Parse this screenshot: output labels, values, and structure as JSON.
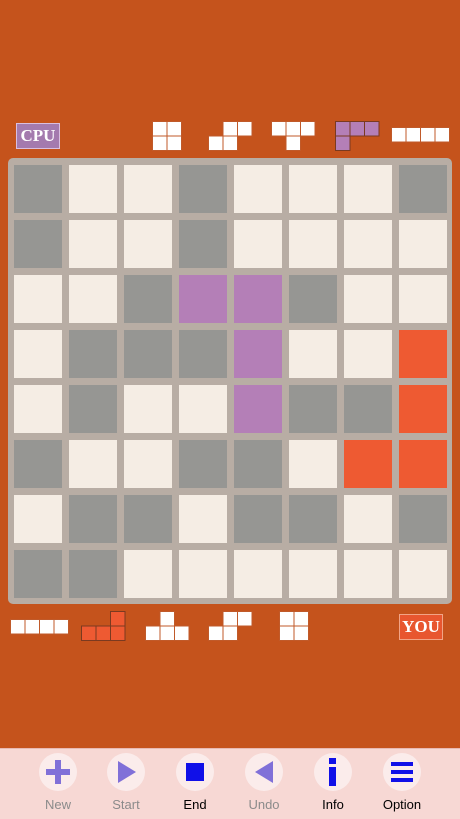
{
  "labels": {
    "cpu": "CPU",
    "you": "YOU"
  },
  "colors": {
    "background": "#c5531c",
    "board": "#b8ada4",
    "empty": "#f5ede4",
    "gray": "#969693",
    "cpu": "#b47fb7",
    "you": "#ee5a32",
    "tray_piece": "#ffffff"
  },
  "board": {
    "grid": [
      "GEEGEEEG",
      "GEEGEEEE",
      "EEGCCGEE",
      "EGGGCEEY",
      "EGEECGGY",
      "GEEGGEYY",
      "EGGEGGEG",
      "GGEEEEEE"
    ]
  },
  "cpu_pieces": [
    {
      "name": "square",
      "cells": [
        [
          0,
          0
        ],
        [
          1,
          0
        ],
        [
          0,
          1
        ],
        [
          1,
          1
        ]
      ],
      "used": false
    },
    {
      "name": "s-tetromino",
      "cells": [
        [
          1,
          0
        ],
        [
          2,
          0
        ],
        [
          0,
          1
        ],
        [
          1,
          1
        ]
      ],
      "used": false
    },
    {
      "name": "t-tetromino",
      "cells": [
        [
          0,
          0
        ],
        [
          1,
          0
        ],
        [
          2,
          0
        ],
        [
          1,
          1
        ]
      ],
      "used": false
    },
    {
      "name": "l-tetromino",
      "cells": [
        [
          0,
          0
        ],
        [
          1,
          0
        ],
        [
          2,
          0
        ],
        [
          0,
          1
        ]
      ],
      "used": true
    },
    {
      "name": "i-tetromino",
      "cells": [
        [
          0,
          0
        ],
        [
          1,
          0
        ],
        [
          2,
          0
        ],
        [
          3,
          0
        ]
      ],
      "used": false
    }
  ],
  "you_pieces": [
    {
      "name": "i-tetromino",
      "cells": [
        [
          0,
          0
        ],
        [
          1,
          0
        ],
        [
          2,
          0
        ],
        [
          3,
          0
        ]
      ],
      "used": false
    },
    {
      "name": "l-tetromino",
      "cells": [
        [
          2,
          0
        ],
        [
          0,
          1
        ],
        [
          1,
          1
        ],
        [
          2,
          1
        ]
      ],
      "used": true
    },
    {
      "name": "t-tetromino",
      "cells": [
        [
          1,
          0
        ],
        [
          0,
          1
        ],
        [
          1,
          1
        ],
        [
          2,
          1
        ]
      ],
      "used": false
    },
    {
      "name": "s-tetromino",
      "cells": [
        [
          1,
          0
        ],
        [
          2,
          0
        ],
        [
          0,
          1
        ],
        [
          1,
          1
        ]
      ],
      "used": false
    },
    {
      "name": "square",
      "cells": [
        [
          0,
          0
        ],
        [
          1,
          0
        ],
        [
          0,
          1
        ],
        [
          1,
          1
        ]
      ],
      "used": false
    }
  ],
  "toolbar": {
    "buttons": [
      {
        "label": "New",
        "icon": "plus-icon",
        "enabled": false
      },
      {
        "label": "Start",
        "icon": "play-icon",
        "enabled": false
      },
      {
        "label": "End",
        "icon": "stop-icon",
        "enabled": true
      },
      {
        "label": "Undo",
        "icon": "undo-icon",
        "enabled": false
      },
      {
        "label": "Info",
        "icon": "info-icon",
        "enabled": true
      },
      {
        "label": "Option",
        "icon": "menu-icon",
        "enabled": true
      }
    ]
  }
}
